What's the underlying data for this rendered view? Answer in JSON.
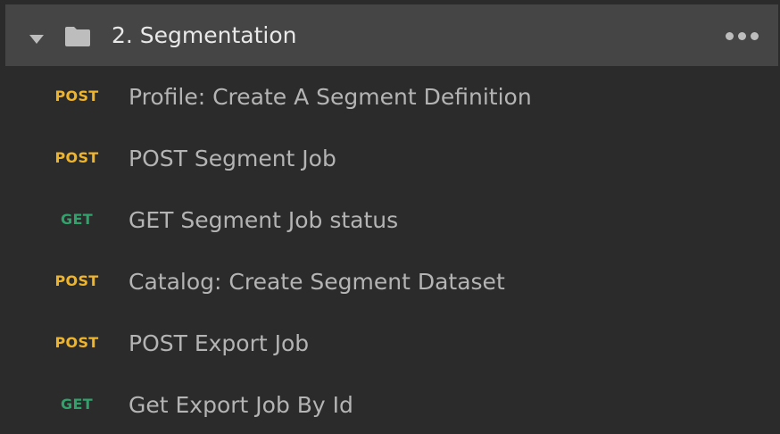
{
  "folder": {
    "title": "2. Segmentation",
    "expanded_icon": "caret-down-icon",
    "icon": "folder-icon",
    "menu_icon": "more-horizontal-icon"
  },
  "requests": [
    {
      "method": "POST",
      "name": "Profile: Create A Segment Definition"
    },
    {
      "method": "POST",
      "name": "POST Segment Job"
    },
    {
      "method": "GET",
      "name": "GET Segment Job status"
    },
    {
      "method": "POST",
      "name": "Catalog: Create Segment Dataset"
    },
    {
      "method": "POST",
      "name": "POST Export Job"
    },
    {
      "method": "GET",
      "name": "Get Export Job By Id"
    }
  ],
  "colors": {
    "post": "#f0b429",
    "get": "#2fa36b",
    "folder_row_bg": "#454545",
    "panel_bg": "#2b2b2b"
  }
}
